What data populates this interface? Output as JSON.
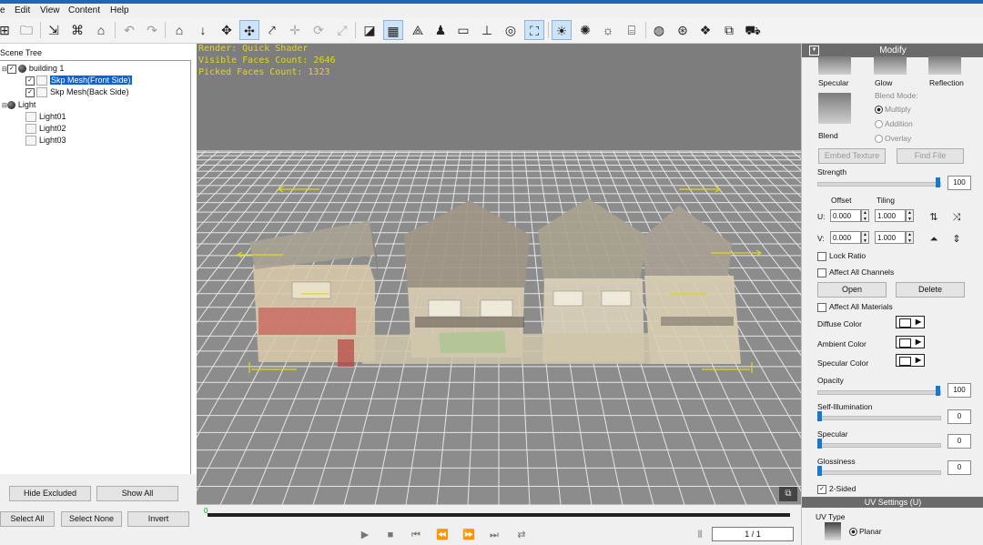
{
  "menu": [
    {
      "label": "e"
    },
    {
      "label": "Edit"
    },
    {
      "label": "View"
    },
    {
      "label": "Content"
    },
    {
      "label": "Help"
    }
  ],
  "left_panel": {
    "title": "Scene Tree",
    "tree": [
      {
        "label": "building 1"
      },
      {
        "label": "Skp Mesh(Front Side)"
      },
      {
        "label": "Skp Mesh(Back Side)"
      },
      {
        "label": "Light"
      },
      {
        "label": "Light01"
      },
      {
        "label": "Light02"
      },
      {
        "label": "Light03"
      }
    ],
    "hide_excluded": "Hide Excluded",
    "show_all": "Show All",
    "select_all": "Select All",
    "select_none": "Select None",
    "invert": "Invert"
  },
  "viewport": {
    "render": "Render: Quick Shader",
    "visible_faces": "Visible Faces Count: 2646",
    "picked_faces": "Picked Faces Count: 1323"
  },
  "timeline": {
    "start": "0",
    "frame": "1 / 1"
  },
  "modify": {
    "title": "Modify",
    "specular": "Specular",
    "glow": "Glow",
    "reflection": "Reflection",
    "blend": "Blend",
    "blend_mode": "Blend Mode:",
    "multiply": "Multiply",
    "addition": "Addition",
    "overlay": "Overlay",
    "embed_texture": "Embed Texture",
    "find_file": "Find File",
    "strength": "Strength",
    "strength_value": "100",
    "offset": "Offset",
    "tiling": "Tiling",
    "u_label": "U:",
    "v_label": "V:",
    "u_offset": "0.000",
    "u_tiling": "1.000",
    "v_offset": "0.000",
    "v_tiling": "1.000",
    "lock_ratio": "Lock Ratio",
    "affect_all_channels": "Affect All Channels",
    "open": "Open",
    "delete": "Delete",
    "affect_all_materials": "Affect All Materials",
    "diffuse_color": "Diffuse Color",
    "ambient_color": "Ambient Color",
    "specular_color": "Specular Color",
    "opacity": "Opacity",
    "opacity_value": "100",
    "self_illumination": "Self-Illumination",
    "self_illumination_value": "0",
    "specular_level": "Specular",
    "specular_level_value": "0",
    "glossiness": "Glossiness",
    "glossiness_value": "0",
    "two_sided": "2-Sided",
    "uv_settings": "UV Settings (U)",
    "uv_type": "UV Type",
    "planar": "Planar"
  },
  "colors": {
    "accent": "#1a78c8",
    "selection": "#0a64d4",
    "overlay_text": "#e2d51f",
    "panel_header": "#6b6b6b"
  }
}
